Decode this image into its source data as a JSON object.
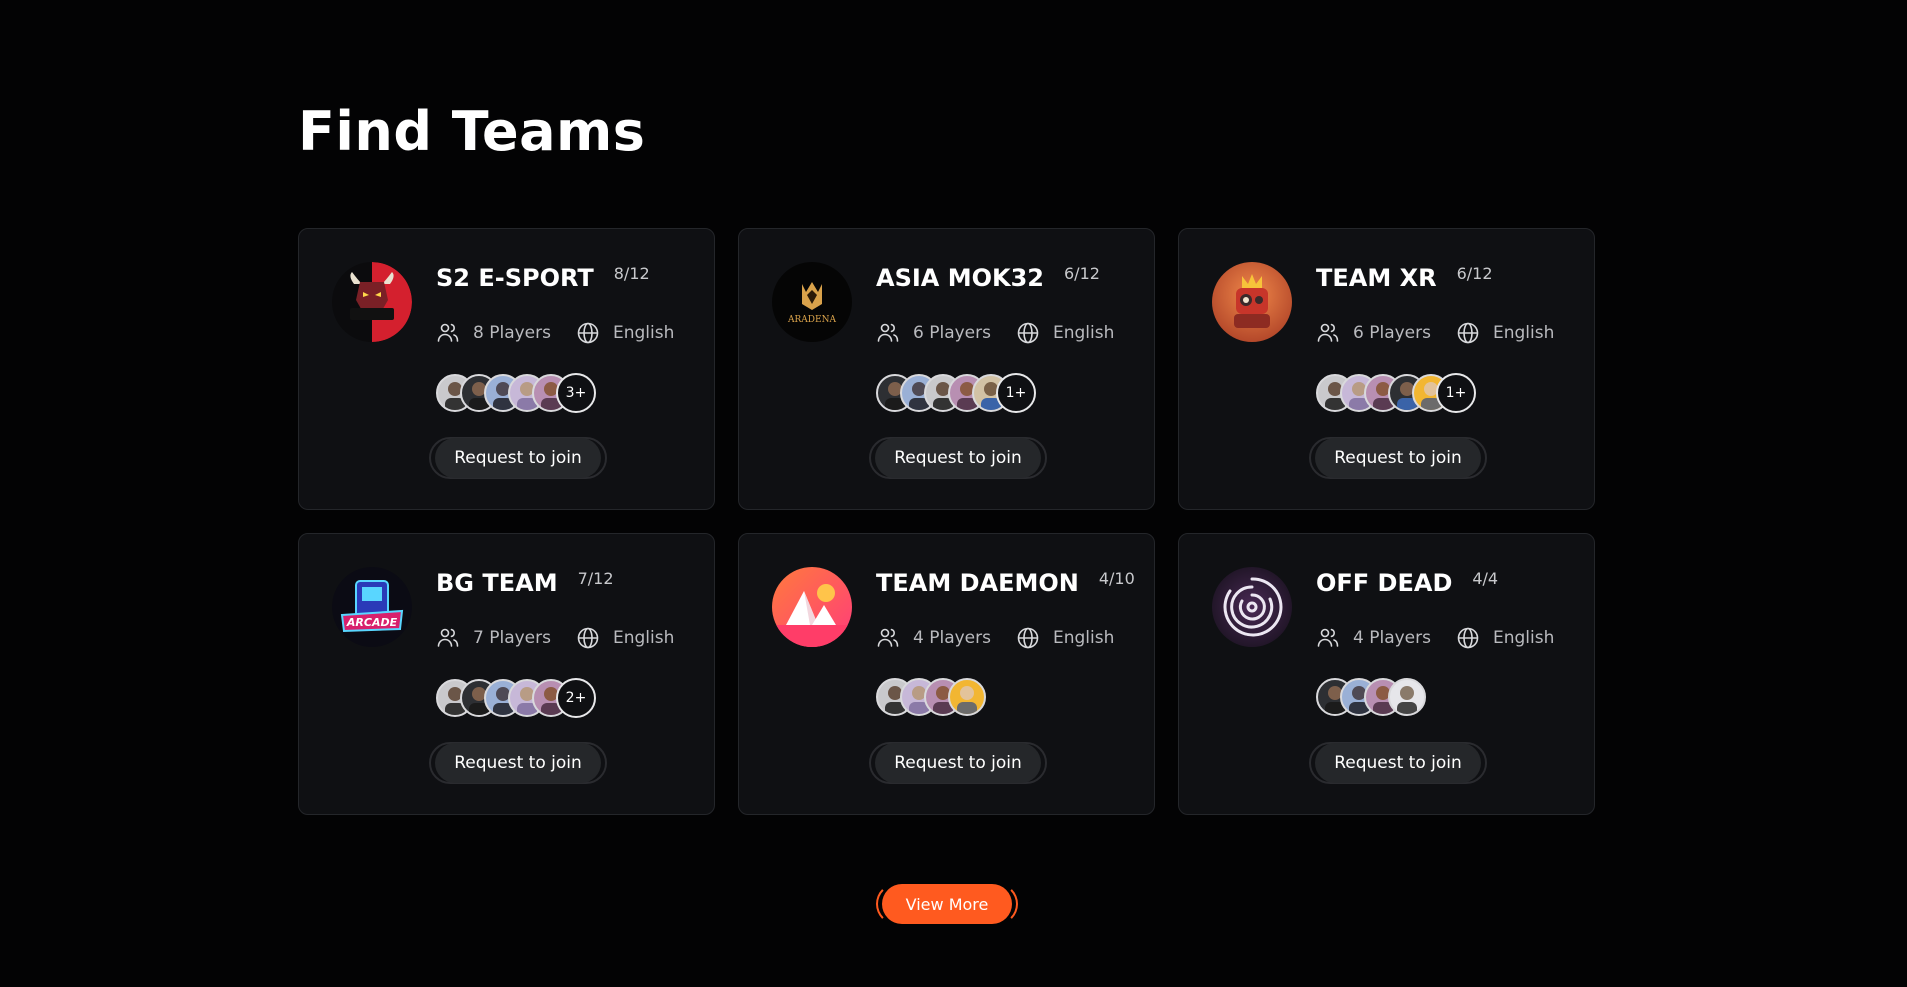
{
  "page": {
    "title": "Find Teams"
  },
  "colors": {
    "background": "#030304",
    "card": "#0f1013",
    "accent": "#ff5a1f",
    "button": "#25272a"
  },
  "icons": {
    "players": "users-icon",
    "language": "globe-icon"
  },
  "teams": [
    {
      "name": "S2 E-SPORT",
      "count": "8/12",
      "players": "8 Players",
      "language": "English",
      "more": "3+",
      "avatars": 5,
      "logo": "gaming-bull-logo",
      "join_label": "Request to join"
    },
    {
      "name": "ASIA MOK32",
      "count": "6/12",
      "players": "6 Players",
      "language": "English",
      "more": "1+",
      "avatars": 5,
      "logo": "aradena-crown-logo",
      "logo_text": "ARADENA",
      "join_label": "Request to join"
    },
    {
      "name": "TEAM XR",
      "count": "6/12",
      "players": "6 Players",
      "language": "English",
      "more": "1+",
      "avatars": 5,
      "logo": "robot-logo",
      "join_label": "Request to join"
    },
    {
      "name": "BG TEAM",
      "count": "7/12",
      "players": "7 Players",
      "language": "English",
      "more": "2+",
      "avatars": 5,
      "logo": "arcade-logo",
      "logo_text": "ARCADE",
      "join_label": "Request to join"
    },
    {
      "name": "TEAM DAEMON",
      "count": "4/10",
      "players": "4 Players",
      "language": "English",
      "more": "",
      "avatars": 4,
      "logo": "pyramids-sun-logo",
      "join_label": "Request to join"
    },
    {
      "name": "OFF DEAD",
      "count": "4/4",
      "players": "4 Players",
      "language": "English",
      "more": "",
      "avatars": 4,
      "logo": "maze-logo",
      "join_label": "Request to join"
    }
  ],
  "footer": {
    "view_more_label": "View More"
  }
}
